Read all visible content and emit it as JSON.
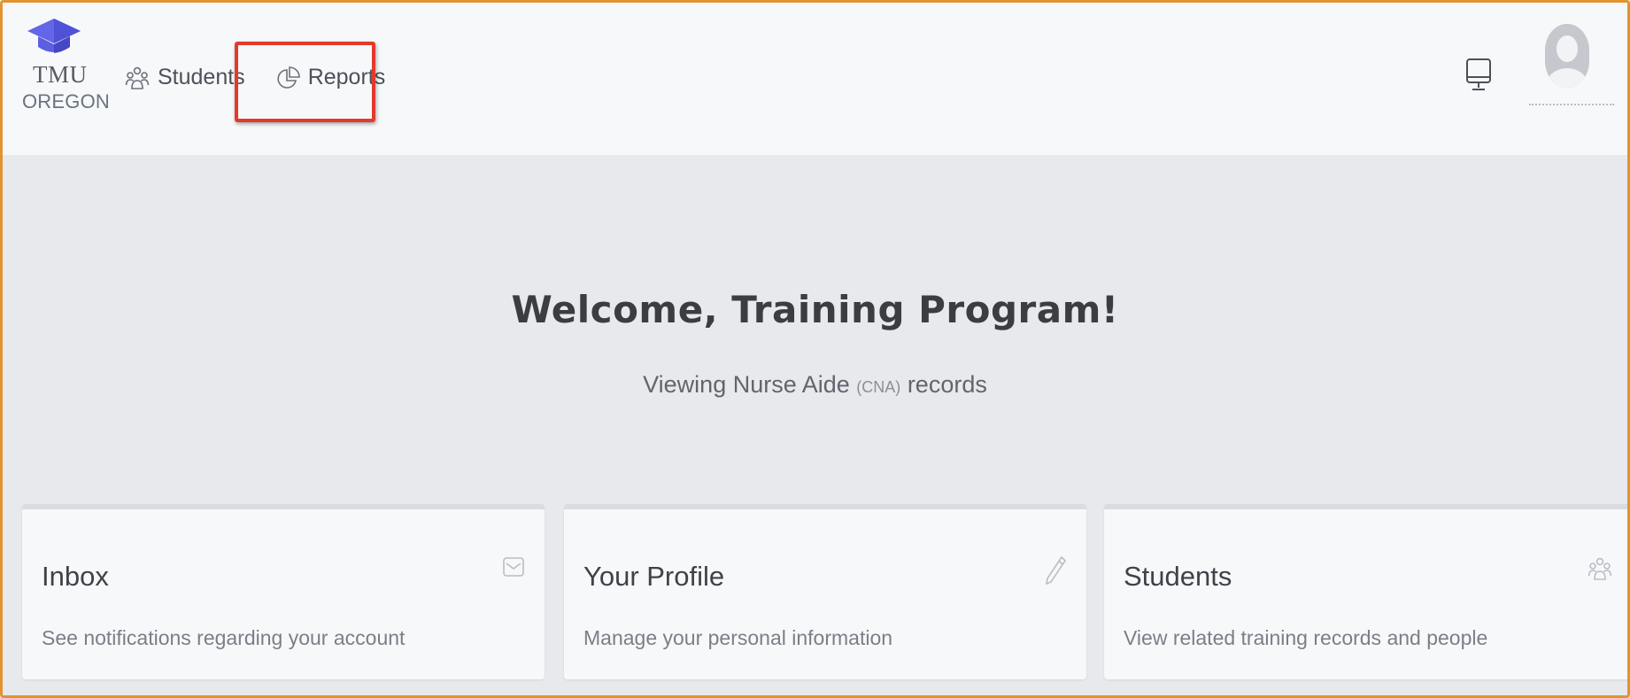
{
  "logo": {
    "line1": "TMU",
    "line2": "OREGON",
    "icon": "graduation-cap-icon",
    "color": "#5b5fe0"
  },
  "nav": {
    "items": [
      {
        "label": "Students",
        "icon": "people-icon"
      },
      {
        "label": "Reports",
        "icon": "pie-chart-icon"
      }
    ]
  },
  "header_actions": {
    "device_icon": "monitor-icon",
    "avatar_icon": "user-avatar-icon"
  },
  "welcome": {
    "title": "Welcome, Training Program!",
    "viewing_prefix": "Viewing Nurse Aide",
    "viewing_abbr": "(CNA)",
    "viewing_suffix": "records"
  },
  "cards": [
    {
      "title": "Inbox",
      "description": "See notifications regarding your account",
      "icon": "mail-icon"
    },
    {
      "title": "Your Profile",
      "description": "Manage your personal information",
      "icon": "pencil-icon"
    },
    {
      "title": "Students",
      "description": "View related training records and people",
      "icon": "people-icon"
    }
  ],
  "colors": {
    "highlight": "#e23a2b",
    "frame": "#e2932f",
    "background": "#e8e9ec",
    "panel": "#f7f8fa"
  }
}
